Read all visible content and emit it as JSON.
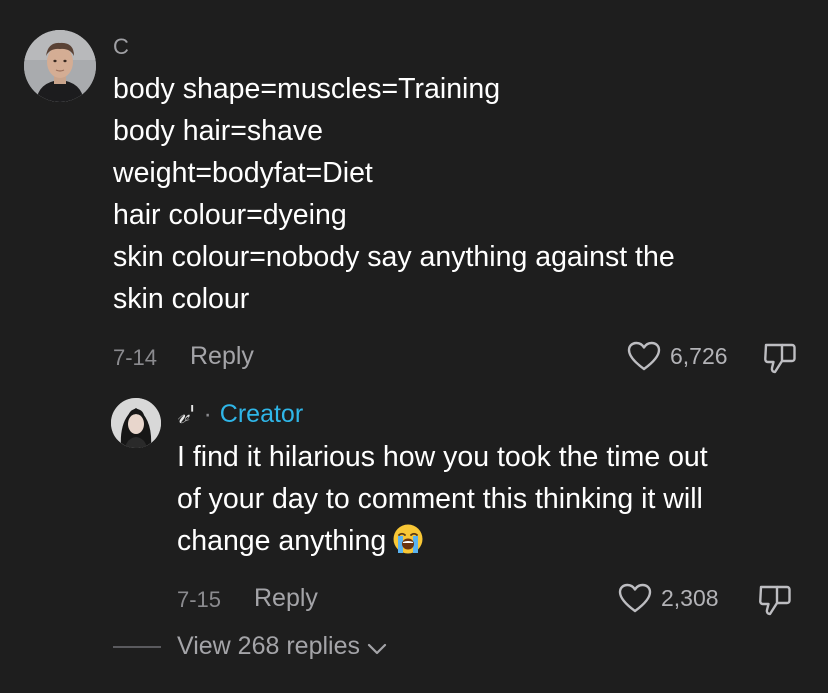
{
  "top_comment": {
    "username": "C",
    "lines": [
      "body shape=muscles=Training",
      "body hair=shave",
      "weight=bodyfat=Diet",
      "hair colour=dyeing",
      "skin colour=nobody say anything against the",
      "skin colour"
    ],
    "date": "7-14",
    "reply_label": "Reply",
    "likes": "6,726"
  },
  "reply": {
    "username": "𝓋'",
    "separator": "·",
    "badge": "Creator",
    "lines": [
      "I find it hilarious how you took the time out",
      "of your day to comment this thinking it will",
      "change anything"
    ],
    "emoji": "loudly-crying-face",
    "date": "7-15",
    "reply_label": "Reply",
    "likes": "2,308"
  },
  "view_replies": {
    "label": "View 268 replies",
    "chevron": "⌄"
  },
  "colors": {
    "background": "#1e1e1e",
    "text": "#ffffff",
    "muted": "#8b8b8f",
    "creator": "#2fb6e8"
  }
}
